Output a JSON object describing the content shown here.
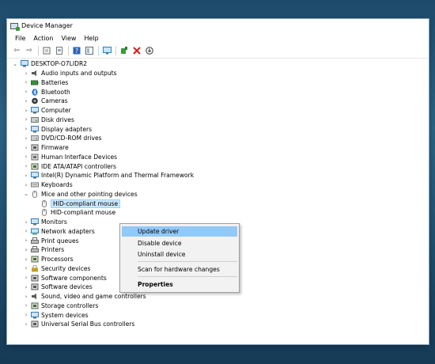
{
  "window": {
    "title": "Device Manager"
  },
  "menu": [
    "File",
    "Action",
    "View",
    "Help"
  ],
  "toolbar_icons": [
    "back-icon",
    "forward-icon",
    "properties-icon",
    "sheet-icon",
    "help-icon",
    "panel-icon",
    "monitor-icon",
    "update-driver-icon",
    "uninstall-icon",
    "download-icon"
  ],
  "tree": {
    "root": "DESKTOP-O7LIDR2",
    "items": [
      {
        "label": "Audio inputs and outputs",
        "icon": "speaker-icon",
        "color": "#5a5a5a"
      },
      {
        "label": "Batteries",
        "icon": "battery-icon",
        "color": "#3a8f3a"
      },
      {
        "label": "Bluetooth",
        "icon": "bluetooth-icon",
        "color": "#1b6fd0"
      },
      {
        "label": "Cameras",
        "icon": "camera-icon",
        "color": "#555555"
      },
      {
        "label": "Computer",
        "icon": "computer-icon",
        "color": "#2f7fc0"
      },
      {
        "label": "Disk drives",
        "icon": "disk-icon",
        "color": "#777777"
      },
      {
        "label": "Display adapters",
        "icon": "display-icon",
        "color": "#2f7fc0"
      },
      {
        "label": "DVD/CD-ROM drives",
        "icon": "dvd-icon",
        "color": "#888888"
      },
      {
        "label": "Firmware",
        "icon": "chip-icon",
        "color": "#555555"
      },
      {
        "label": "Human Interface Devices",
        "icon": "hid-icon",
        "color": "#6a6a6a"
      },
      {
        "label": "IDE ATA/ATAPI controllers",
        "icon": "controller-icon",
        "color": "#4a6a3a"
      },
      {
        "label": "Intel(R) Dynamic Platform and Thermal Framework",
        "icon": "platform-icon",
        "color": "#2f7fc0"
      },
      {
        "label": "Keyboards",
        "icon": "keyboard-icon",
        "color": "#777777"
      },
      {
        "label": "Mice and other pointing devices",
        "icon": "mouse-icon",
        "color": "#777777",
        "expanded": true
      },
      {
        "label": "HID-compliant mouse",
        "icon": "mouse-icon",
        "color": "#777777",
        "child": true,
        "selected": true
      },
      {
        "label": "HID-compliant mouse",
        "icon": "mouse-icon",
        "color": "#777777",
        "child": true
      },
      {
        "label": "Monitors",
        "icon": "monitor-icon",
        "color": "#2f7fc0"
      },
      {
        "label": "Network adapters",
        "icon": "network-icon",
        "color": "#2f7fc0"
      },
      {
        "label": "Print queues",
        "icon": "printer-icon",
        "color": "#666666"
      },
      {
        "label": "Printers",
        "icon": "printer-icon",
        "color": "#666666"
      },
      {
        "label": "Processors",
        "icon": "processor-icon",
        "color": "#4a6a3a"
      },
      {
        "label": "Security devices",
        "icon": "security-icon",
        "color": "#c8a020"
      },
      {
        "label": "Software components",
        "icon": "component-icon",
        "color": "#555555"
      },
      {
        "label": "Software devices",
        "icon": "software-icon",
        "color": "#555555"
      },
      {
        "label": "Sound, video and game controllers",
        "icon": "sound-icon",
        "color": "#5a5a5a"
      },
      {
        "label": "Storage controllers",
        "icon": "storage-icon",
        "color": "#4a6a3a"
      },
      {
        "label": "System devices",
        "icon": "system-icon",
        "color": "#2f7fc0"
      },
      {
        "label": "Universal Serial Bus controllers",
        "icon": "usb-icon",
        "color": "#555555"
      }
    ]
  },
  "context_menu": {
    "update": "Update driver",
    "disable": "Disable device",
    "uninstall": "Uninstall device",
    "scan": "Scan for hardware changes",
    "properties": "Properties"
  }
}
